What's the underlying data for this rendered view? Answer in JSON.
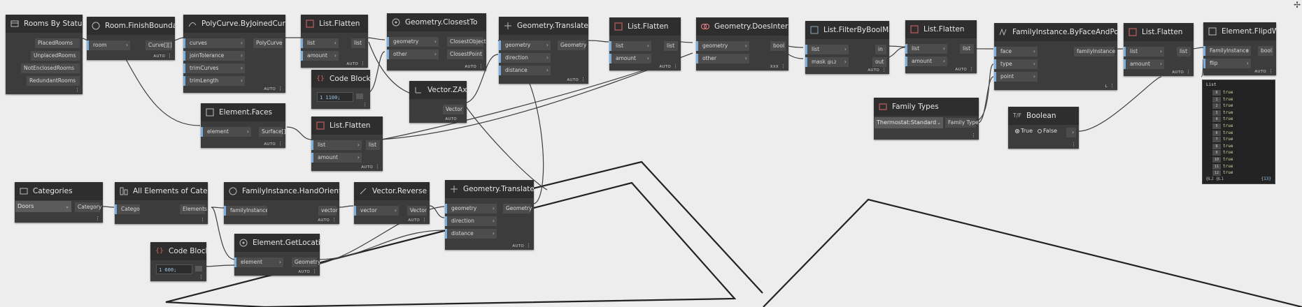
{
  "nodes": {
    "rooms_by_status": {
      "title": "Rooms By Status",
      "outputs": [
        "PlacedRooms",
        "UnplacedRooms",
        "NotEnclosedRooms",
        "RedundantRooms"
      ]
    },
    "room_finish_boundary": {
      "title": "Room.FinishBoundary",
      "inputs": [
        "room"
      ],
      "outputs": [
        "Curve[][]"
      ],
      "lacing": "AUTO"
    },
    "polycurve_by_joined_curves": {
      "title": "PolyCurve.ByJoinedCurves",
      "inputs": [
        "curves",
        "joinTolerance",
        "trimCurves",
        "trimLength"
      ],
      "outputs": [
        "PolyCurve"
      ],
      "lacing": "AUTO"
    },
    "list_flatten_1": {
      "title": "List.Flatten",
      "inputs": [
        "list",
        "amount"
      ],
      "outputs": [
        "list"
      ],
      "lacing": "AUTO"
    },
    "geometry_closest_to": {
      "title": "Geometry.ClosestTo",
      "inputs": [
        "geometry",
        "other"
      ],
      "outputs": [
        "ClosestObject",
        "ClosestPoint"
      ],
      "lacing": "AUTO"
    },
    "geometry_translate_1": {
      "title": "Geometry.Translate",
      "inputs": [
        "geometry",
        "direction",
        "distance"
      ],
      "outputs": [
        "Geometry"
      ],
      "lacing": "AUTO"
    },
    "list_flatten_2": {
      "title": "List.Flatten",
      "inputs": [
        "list",
        "amount"
      ],
      "outputs": [
        "list"
      ],
      "lacing": "AUTO"
    },
    "geometry_does_intersect": {
      "title": "Geometry.DoesIntersect",
      "inputs": [
        "geometry",
        "other"
      ],
      "outputs": [
        "bool"
      ],
      "lacing": "XXX"
    },
    "list_filter_by_bool_mask": {
      "title": "List.FilterByBoolMask",
      "inputs": [
        "list",
        "mask"
      ],
      "mask_badge": "@L2",
      "outputs": [
        "in",
        "out"
      ],
      "lacing": "AUTO"
    },
    "list_flatten_3": {
      "title": "List.Flatten",
      "inputs": [
        "list",
        "amount"
      ],
      "outputs": [
        "list"
      ],
      "lacing": "AUTO"
    },
    "family_instance_by_face_and_point": {
      "title": "FamilyInstance.ByFaceAndPoint",
      "inputs": [
        "face",
        "type",
        "point"
      ],
      "outputs": [
        "familyInstance"
      ],
      "lacing": "L"
    },
    "list_flatten_4": {
      "title": "List.Flatten",
      "inputs": [
        "list",
        "amount"
      ],
      "outputs": [
        "list"
      ],
      "lacing": "AUTO"
    },
    "element_flip_work_plane": {
      "title": "Element.FlipdWorkPlane",
      "inputs": [
        "FamilyInstance",
        "flip"
      ],
      "outputs": [
        "bool"
      ],
      "lacing": "AUTO"
    },
    "code_block_1": {
      "title": "Code Block",
      "value": "1 1100;"
    },
    "vector_z_axis": {
      "title": "Vector.ZAxis",
      "outputs": [
        "Vector"
      ],
      "lacing": "AUTO"
    },
    "element_faces": {
      "title": "Element.Faces",
      "inputs": [
        "element"
      ],
      "outputs": [
        "Surface[]"
      ],
      "lacing": "AUTO"
    },
    "list_flatten_5": {
      "title": "List.Flatten",
      "inputs": [
        "list",
        "amount"
      ],
      "outputs": [
        "list"
      ],
      "lacing": "AUTO"
    },
    "family_types": {
      "title": "Family Types",
      "selected": "Thermostat:Standard",
      "outputs": [
        "Family Type"
      ]
    },
    "boolean": {
      "title": "Boolean",
      "true_label": "True",
      "false_label": "False"
    },
    "categories": {
      "title": "Categories",
      "selected": "Doors",
      "outputs": [
        "Category"
      ]
    },
    "all_elements_of_category": {
      "title": "All Elements of Category",
      "inputs": [
        "Category"
      ],
      "outputs": [
        "Elements"
      ]
    },
    "family_instance_hand_orientation": {
      "title": "FamilyInstance.HandOrientation",
      "inputs": [
        "familyInstance"
      ],
      "outputs": [
        "vector"
      ],
      "lacing": "AUTO"
    },
    "vector_reverse": {
      "title": "Vector.Reverse",
      "inputs": [
        "vector"
      ],
      "outputs": [
        "Vector"
      ],
      "lacing": "AUTO"
    },
    "geometry_translate_2": {
      "title": "Geometry.Translate",
      "inputs": [
        "geometry",
        "direction",
        "distance"
      ],
      "outputs": [
        "Geometry"
      ],
      "lacing": "AUTO"
    },
    "element_get_location": {
      "title": "Element.GetLocation",
      "inputs": [
        "element"
      ],
      "outputs": [
        "Geometry"
      ],
      "lacing": "AUTO"
    },
    "code_block_2": {
      "title": "Code Block",
      "value": "1 600;"
    }
  },
  "watch": {
    "header": "List",
    "items": [
      {
        "index": "0",
        "value": "true"
      },
      {
        "index": "1",
        "value": "true"
      },
      {
        "index": "2",
        "value": "true"
      },
      {
        "index": "3",
        "value": "true"
      },
      {
        "index": "4",
        "value": "true"
      },
      {
        "index": "5",
        "value": "true"
      },
      {
        "index": "6",
        "value": "true"
      },
      {
        "index": "7",
        "value": "true"
      },
      {
        "index": "8",
        "value": "true"
      },
      {
        "index": "9",
        "value": "true"
      },
      {
        "index": "10",
        "value": "true"
      },
      {
        "index": "11",
        "value": "true"
      },
      {
        "index": "12",
        "value": "true"
      }
    ],
    "footer_left": "@L2 @L1",
    "footer_right": "{13}"
  },
  "colors": {
    "canvas": "#ededed",
    "node_body": "#3c3c3c",
    "node_header": "#2e2e2e",
    "port": "#4c4c4c",
    "wire": "#3a3a3a",
    "input_marker": "#7aaedc"
  }
}
